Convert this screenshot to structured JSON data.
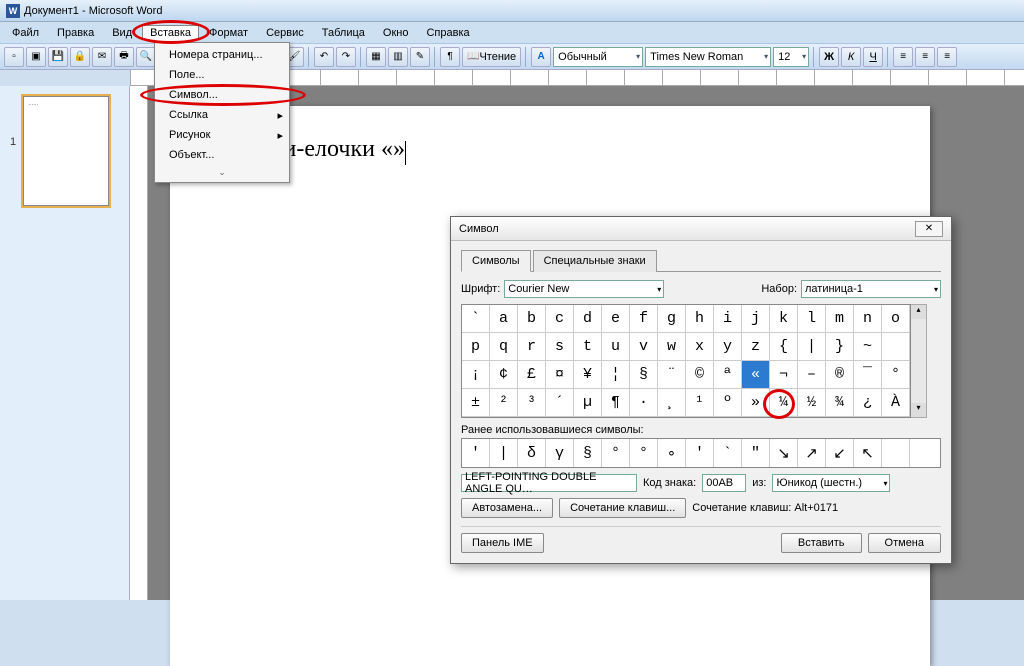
{
  "title": "Документ1 - Microsoft Word",
  "menubar": [
    "Файл",
    "Правка",
    "Вид",
    "Вставка",
    "Формат",
    "Сервис",
    "Таблица",
    "Окно",
    "Справка"
  ],
  "active_menu_index": 3,
  "toolbar": {
    "read_label": "Чтение",
    "style": "Обычный",
    "font": "Times New Roman",
    "size": "12",
    "bold": "Ж",
    "italic": "К",
    "underline": "Ч"
  },
  "dropdown_items": [
    {
      "label": "Номера страниц...",
      "sub": false
    },
    {
      "label": "Поле...",
      "sub": false
    },
    {
      "label": "Символ...",
      "sub": false
    },
    {
      "label": "Ссылка",
      "sub": true
    },
    {
      "label": "Рисунок",
      "sub": true
    },
    {
      "label": "Объект...",
      "sub": false
    }
  ],
  "page_text": "Кавычки-елочки «»",
  "page_number": "1",
  "dialog": {
    "title": "Символ",
    "tabs": [
      "Символы",
      "Специальные знаки"
    ],
    "font_label": "Шрифт:",
    "font_value": "Courier New",
    "subset_label": "Набор:",
    "subset_value": "латиница-1",
    "grid": [
      [
        "`",
        "a",
        "b",
        "c",
        "d",
        "e",
        "f",
        "g",
        "h",
        "i",
        "j",
        "k",
        "l",
        "m",
        "n",
        "o"
      ],
      [
        "p",
        "q",
        "r",
        "s",
        "t",
        "u",
        "v",
        "w",
        "x",
        "y",
        "z",
        "{",
        "|",
        "}",
        "~",
        ""
      ],
      [
        "¡",
        "¢",
        "£",
        "¤",
        "¥",
        "¦",
        "§",
        "¨",
        "©",
        "ª",
        "«",
        "¬",
        "–",
        "®",
        "¯",
        "°"
      ],
      [
        "±",
        "²",
        "³",
        "´",
        "µ",
        "¶",
        "·",
        "¸",
        "¹",
        "º",
        "»",
        "¼",
        "½",
        "¾",
        "¿",
        "À"
      ]
    ],
    "selected_row": 2,
    "selected_col": 10,
    "recent_label": "Ранее использовавшиеся символы:",
    "recent": [
      "′",
      "|",
      "δ",
      "γ",
      "§",
      "°",
      "°",
      "∘",
      "′",
      "`",
      "″",
      "↘",
      "↗",
      "↙",
      "↖",
      ""
    ],
    "char_name": "LEFT-POINTING DOUBLE ANGLE QU…",
    "code_label": "Код знака:",
    "code_value": "00AB",
    "from_label": "из:",
    "from_value": "Юникод (шестн.)",
    "autocorrect": "Автозамена...",
    "shortcut": "Сочетание клавиш...",
    "shortcut_text": "Сочетание клавиш: Alt+0171",
    "ime": "Панель IME",
    "insert": "Вставить",
    "cancel": "Отмена"
  }
}
